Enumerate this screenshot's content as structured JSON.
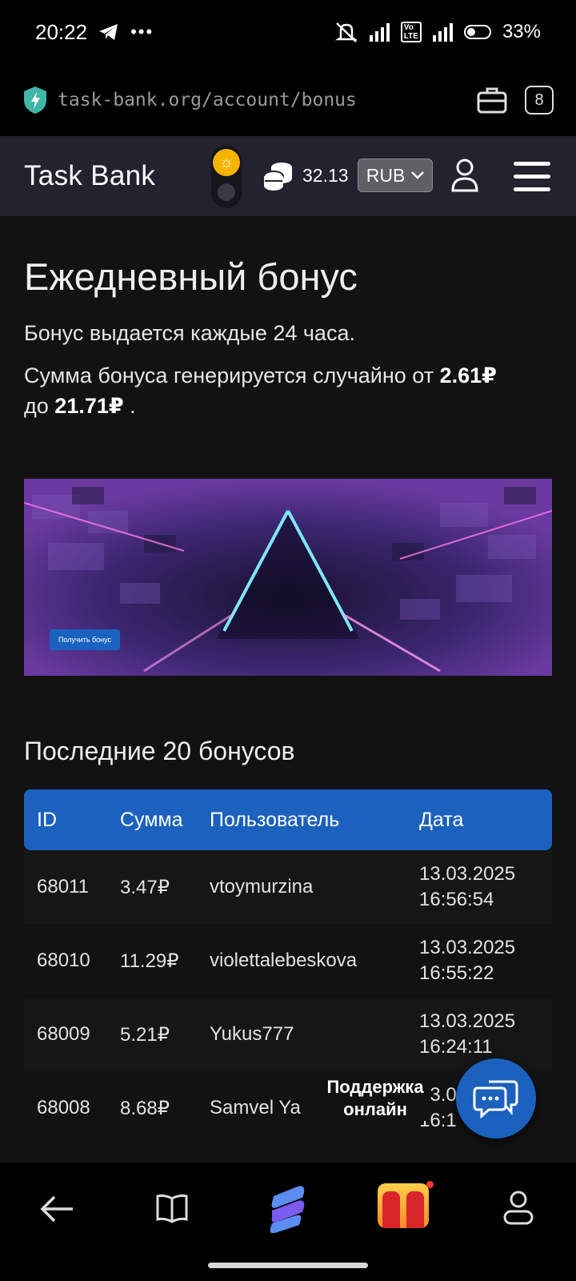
{
  "status_bar": {
    "time": "20:22",
    "battery": "33%"
  },
  "browser": {
    "url": "task-bank.org/account/bonus",
    "tab_count": "8"
  },
  "header": {
    "brand": "Task Bank",
    "balance": "32.13",
    "currency": "RUB"
  },
  "page": {
    "title": "Ежедневный бонус",
    "desc1": "Бонус выдается каждые 24 часа.",
    "desc2_prefix": "Сумма бонуса генерируется случайно от",
    "min_amount": "2.61₽",
    "desc2_mid": "до",
    "max_amount": "21.71₽",
    "desc2_suffix": ".",
    "claim_button": "Получить бонус",
    "section_title": "Последние 20 бонусов"
  },
  "table": {
    "headers": {
      "id": "ID",
      "amount": "Сумма",
      "user": "Пользователь",
      "date": "Дата"
    },
    "rows": [
      {
        "id": "68011",
        "amount": "3.47₽",
        "user": "vtoymurzina",
        "date": "13.03.2025",
        "time": "16:56:54"
      },
      {
        "id": "68010",
        "amount": "11.29₽",
        "user": "violettalebeskova",
        "date": "13.03.2025",
        "time": "16:55:22"
      },
      {
        "id": "68009",
        "amount": "5.21₽",
        "user": "Yukus777",
        "date": "13.03.2025",
        "time": "16:24:11"
      },
      {
        "id": "68008",
        "amount": "8.68₽",
        "user": "Samvel Ya",
        "date": "13.03.2025",
        "time": "16:1"
      }
    ]
  },
  "support": {
    "label_line1": "Поддержка",
    "label_line2": "онлайн"
  },
  "colors": {
    "accent": "#1b61bd",
    "header_bg": "#23222f",
    "page_bg": "#121212",
    "sun": "#f6b400"
  }
}
